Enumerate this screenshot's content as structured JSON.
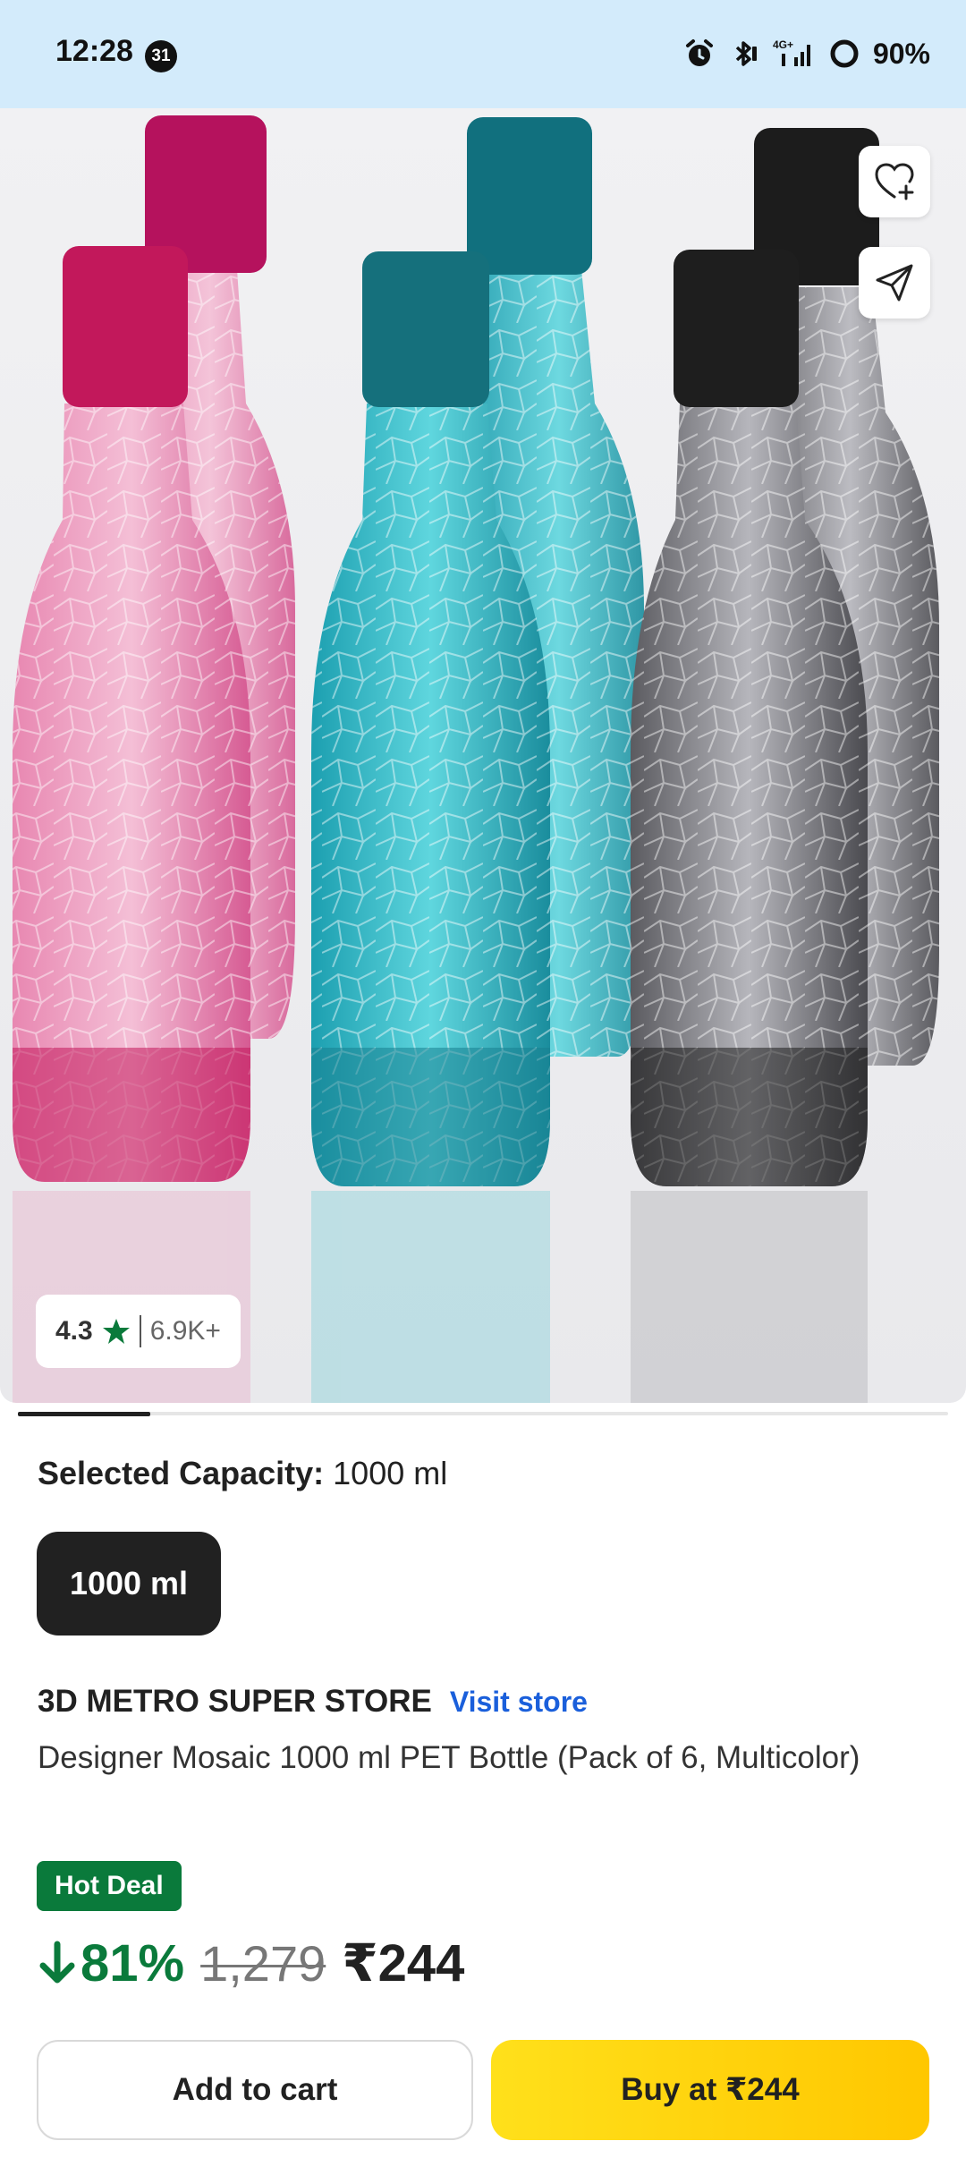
{
  "status_bar": {
    "time": "12:28",
    "calendar_badge": "31",
    "network": "4G+",
    "battery": "90%",
    "icons": [
      "alarm-icon",
      "bluetooth-icon",
      "signal-icon",
      "battery-ring-icon"
    ]
  },
  "product_image": {
    "rating": "4.3",
    "rating_count": "6.9K+",
    "actions": [
      "wishlist-add-icon",
      "share-icon"
    ],
    "bottle_colors": [
      "#c2185b",
      "#17808f",
      "#1e1e1e"
    ]
  },
  "carousel": {
    "active_index": 1,
    "total": 7
  },
  "capacity": {
    "label": "Selected Capacity:",
    "value": "1000 ml",
    "options": [
      "1000 ml"
    ]
  },
  "store": {
    "name": "3D METRO SUPER STORE",
    "visit_label": "Visit store"
  },
  "product": {
    "title": "Designer Mosaic 1000 ml PET Bottle (Pack of 6, Multicolor)"
  },
  "deal": {
    "badge": "Hot Deal",
    "discount": "81%",
    "mrp": "1,279",
    "price": "₹244"
  },
  "buttons": {
    "add_to_cart": "Add to cart",
    "buy": "Buy at ₹244"
  },
  "colors": {
    "status_bar_bg": "#d3ebfb",
    "deal_green": "#0a7a3b",
    "link_blue": "#1a5fdb",
    "buy_yellow": "#ffd400",
    "dark": "#212121"
  }
}
